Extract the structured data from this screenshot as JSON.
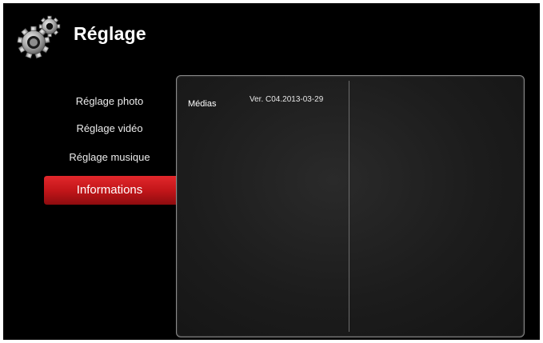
{
  "header": {
    "title": "Réglage",
    "icon": "gears-icon"
  },
  "menu": {
    "items": [
      {
        "label": "Réglage photo",
        "active": false
      },
      {
        "label": "Réglage vidéo",
        "active": false
      },
      {
        "label": "Réglage musique",
        "active": false
      },
      {
        "label": "Informations",
        "active": true
      }
    ]
  },
  "info_panel": {
    "label": "Médias",
    "value": "Ver. C04.2013-03-29"
  },
  "colors": {
    "background": "#000000",
    "active_item": "#c3161a",
    "panel_border": "#8a8a8a"
  }
}
